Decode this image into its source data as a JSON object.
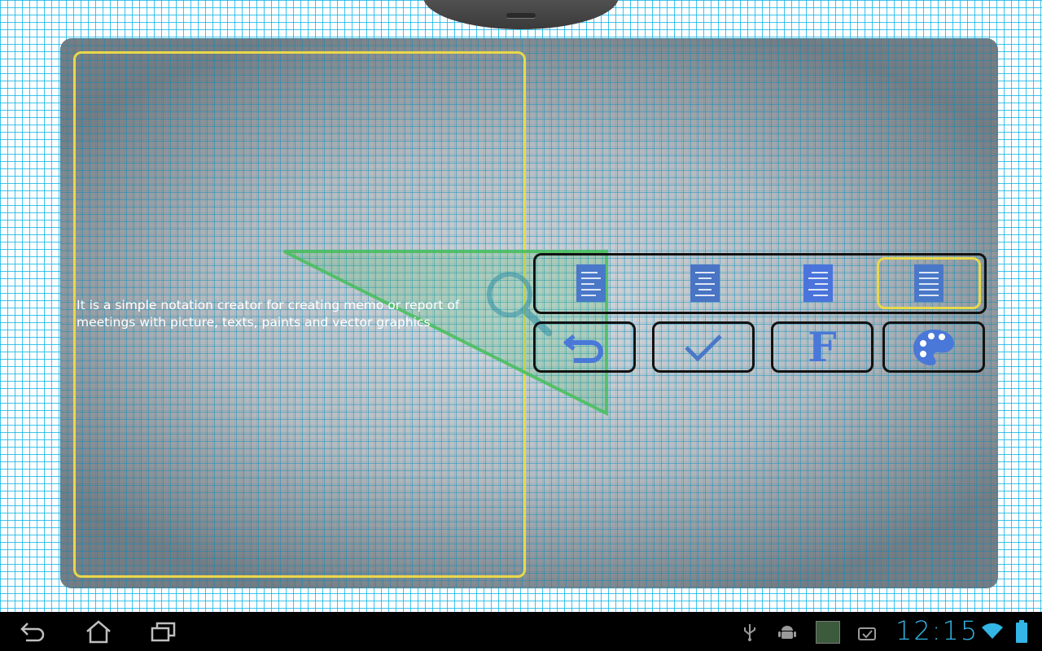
{
  "description": "It is a simple notation creator for creating memo or report of meetings with picture, texts, paints and vector graphics",
  "toolbar": {
    "document_buttons": [
      {
        "icon": "document-icon",
        "color": "#4a78c8"
      },
      {
        "icon": "document-icon",
        "color": "#4a74c4"
      },
      {
        "icon": "document-icon",
        "color": "#4a74dc"
      },
      {
        "icon": "document-icon",
        "color": "#4a78c8",
        "selected": true
      }
    ],
    "actions": [
      {
        "icon": "undo-icon"
      },
      {
        "icon": "checkmark-icon"
      },
      {
        "icon": "font-icon",
        "label": "F"
      },
      {
        "icon": "palette-icon"
      }
    ]
  },
  "system_bar": {
    "time": "12:15",
    "nav_icons": [
      "back-icon",
      "home-icon",
      "recent-apps-icon"
    ],
    "status_icons": [
      "usb-icon",
      "android-debug-icon",
      "screenshot-thumbnail-icon",
      "task-done-icon",
      "wifi-icon",
      "battery-icon"
    ]
  },
  "colors": {
    "accent": "#33b5e5",
    "selection": "#e9d84a",
    "shape_fill": "#3cb45a",
    "icon_blue": "#4a78d8"
  }
}
